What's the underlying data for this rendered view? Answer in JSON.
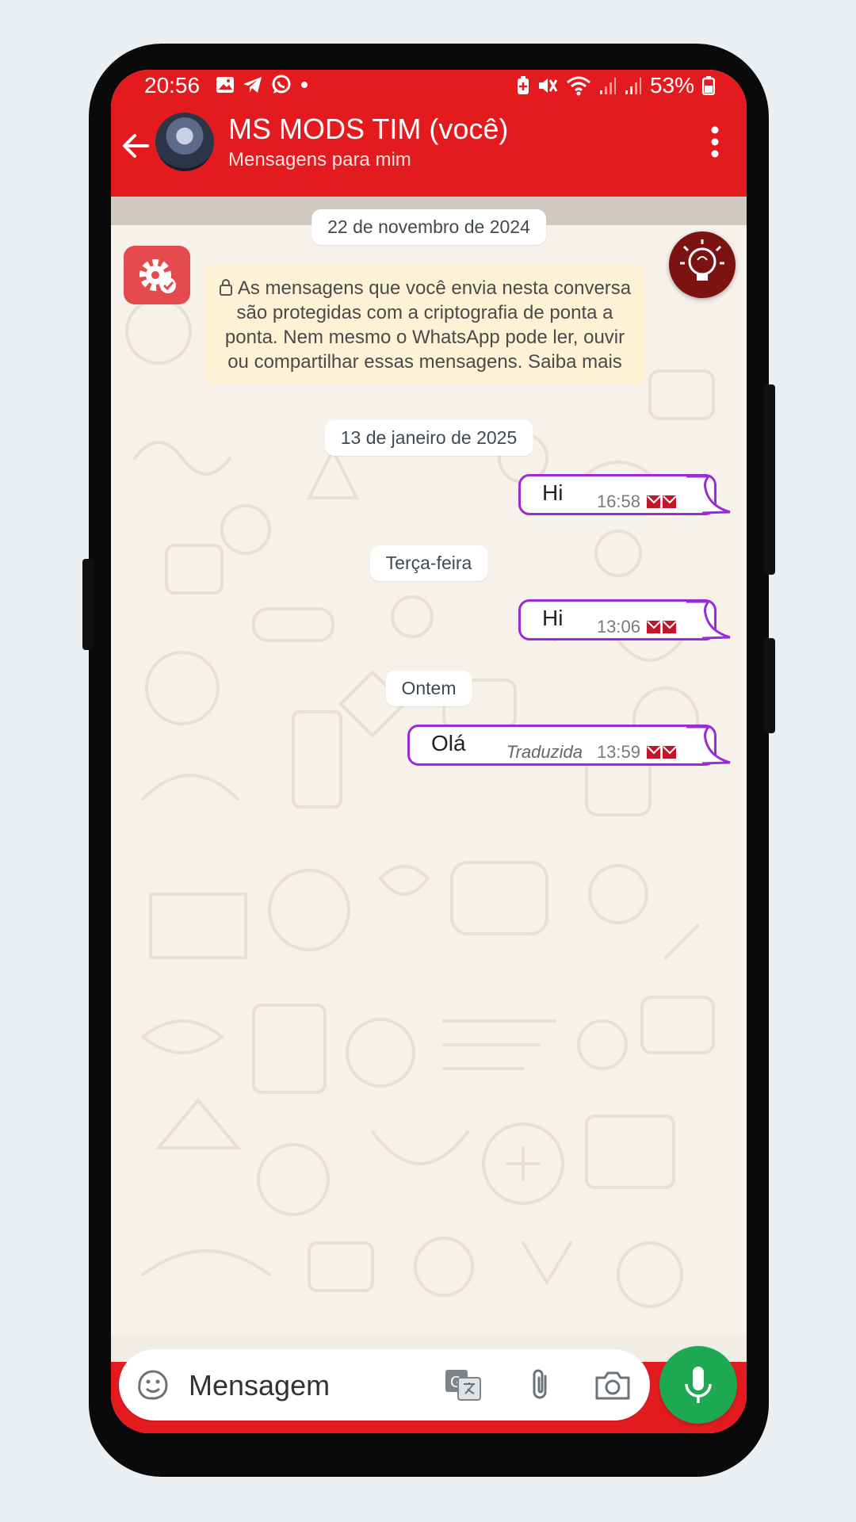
{
  "status_bar": {
    "time": "20:56",
    "battery": "53%",
    "left_icons": [
      "image-icon",
      "telegram-icon",
      "whatsapp-icon",
      "dot-icon"
    ],
    "right_icons": [
      "battery-saver-icon",
      "mute-icon",
      "wifi-icon",
      "signal-icon",
      "signal-icon"
    ]
  },
  "header": {
    "title": "MS MODS TIM (você)",
    "subtitle": "Mensagens para mim",
    "background_color": "#e31b1f"
  },
  "chat": {
    "encryption_notice": "As mensagens que você envia nesta conversa são protegidas com a criptografia de ponta a ponta. Nem mesmo o WhatsApp pode ler, ouvir ou compartilhar essas mensagens. Saiba mais",
    "dates": [
      "22 de novembro de 2024",
      "13 de janeiro de 2025",
      "Terça-feira",
      "Ontem"
    ],
    "messages": [
      {
        "text": "Hi",
        "time": "16:58",
        "status": "read"
      },
      {
        "text": "Hi",
        "time": "13:06",
        "status": "read"
      },
      {
        "text": "Olá",
        "translated_label": "Traduzida",
        "time": "13:59",
        "status": "read"
      }
    ],
    "bubble_border_color": "#9b2bd4"
  },
  "composer": {
    "placeholder": "Mensagem",
    "mic_color": "#1da851"
  }
}
